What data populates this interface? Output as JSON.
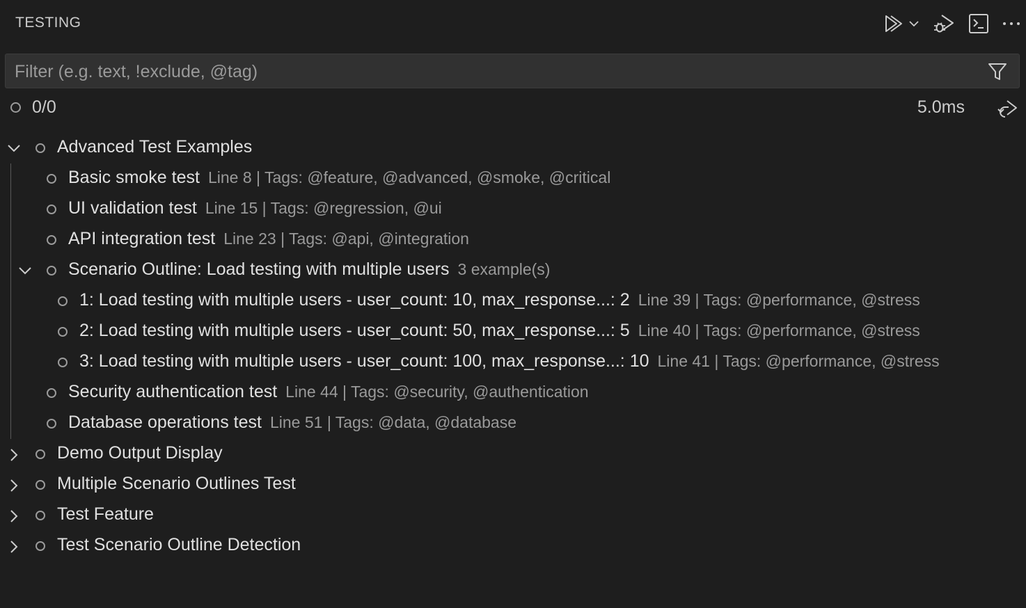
{
  "header": {
    "title": "TESTING"
  },
  "filter": {
    "placeholder": "Filter (e.g. text, !exclude, @tag)"
  },
  "status": {
    "count": "0/0",
    "duration": "5.0ms"
  },
  "tree": {
    "items": [
      {
        "label": "Advanced Test Examples",
        "desc": "",
        "expanded": true
      },
      {
        "label": "Basic smoke test",
        "desc": "Line 8 | Tags: @feature, @advanced, @smoke, @critical"
      },
      {
        "label": "UI validation test",
        "desc": "Line 15 | Tags: @regression, @ui"
      },
      {
        "label": "API integration test",
        "desc": "Line 23 | Tags: @api, @integration"
      },
      {
        "label": "Scenario Outline: Load testing with multiple users",
        "desc": "3 example(s)",
        "expanded": true
      },
      {
        "label": "1: Load testing with multiple users - user_count: 10, max_response...: 2",
        "desc": "Line 39 | Tags: @performance, @stress"
      },
      {
        "label": "2: Load testing with multiple users - user_count: 50, max_response...: 5",
        "desc": "Line 40 | Tags: @performance, @stress"
      },
      {
        "label": "3: Load testing with multiple users - user_count: 100, max_response...: 10",
        "desc": "Line 41 | Tags: @performance, @stress"
      },
      {
        "label": "Security authentication test",
        "desc": "Line 44 | Tags: @security, @authentication"
      },
      {
        "label": "Database operations test",
        "desc": "Line 51 | Tags: @data, @database"
      },
      {
        "label": "Demo Output Display",
        "desc": "",
        "expanded": false
      },
      {
        "label": "Multiple Scenario Outlines Test",
        "desc": "",
        "expanded": false
      },
      {
        "label": "Test Feature",
        "desc": "",
        "expanded": false
      },
      {
        "label": "Test Scenario Outline Detection",
        "desc": "",
        "expanded": false
      }
    ]
  },
  "icons": {
    "run": "run-all-icon",
    "run_dropdown": "chevron-down-icon",
    "debug": "debug-all-icon",
    "terminal": "terminal-icon",
    "more": "more-actions-icon",
    "filter": "filter-icon",
    "rerun": "rerun-icon"
  },
  "colors": {
    "background": "#1e1e1e",
    "filter_background": "#313131",
    "text": "#cccccc",
    "description": "#9a9a9a",
    "status_circle": "#9b9b9b"
  }
}
